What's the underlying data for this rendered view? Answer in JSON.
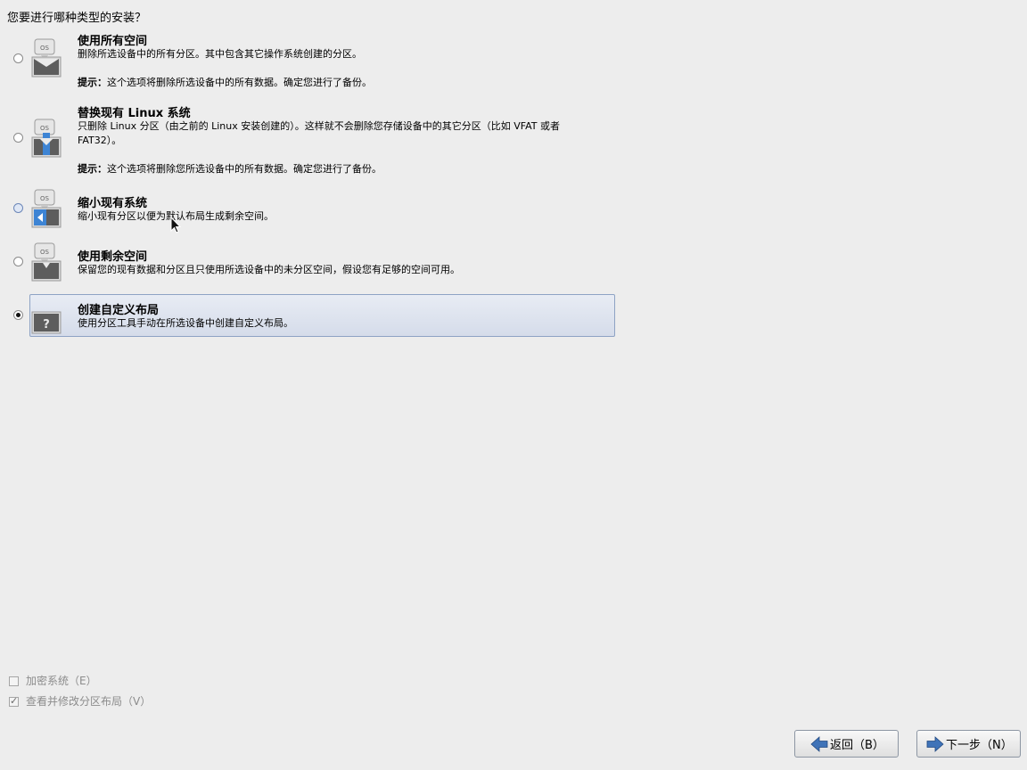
{
  "question": "您要进行哪种类型的安装？",
  "options": [
    {
      "title": "使用所有空间",
      "desc": "删除所选设备中的所有分区。其中包含其它操作系统创建的分区。",
      "tip_label": "提示：",
      "tip": "这个选项将删除所选设备中的所有数据。确定您进行了备份。",
      "icon": "os-disk-full-icon",
      "selected": false
    },
    {
      "title": "替换现有 Linux 系统",
      "desc": "只删除 Linux 分区（由之前的 Linux 安装创建的）。这样就不会删除您存储设备中的其它分区（比如 VFAT 或者 FAT32）。",
      "tip_label": "提示：",
      "tip": "这个选项将删除您所选设备中的所有数据。确定您进行了备份。",
      "icon": "os-disk-replace-icon",
      "selected": false
    },
    {
      "title": "缩小现有系统",
      "desc": "缩小现有分区以便为默认布局生成剩余空间。",
      "icon": "os-disk-shrink-icon",
      "selected": false
    },
    {
      "title": "使用剩余空间",
      "desc": "保留您的现有数据和分区且只使用所选设备中的未分区空间，假设您有足够的空间可用。",
      "icon": "os-disk-free-icon",
      "selected": false
    },
    {
      "title": "创建自定义布局",
      "desc": "使用分区工具手动在所选设备中创建自定义布局。",
      "icon": "custom-layout-question-icon",
      "selected": true
    }
  ],
  "checkboxes": [
    {
      "label": "加密系统（E）",
      "checked": false
    },
    {
      "label": "查看并修改分区布局（V）",
      "checked": true
    }
  ],
  "buttons": {
    "back": "返回（B）",
    "next": "下一步（N）"
  },
  "icon_text": {
    "os": "OS",
    "question": "?"
  }
}
